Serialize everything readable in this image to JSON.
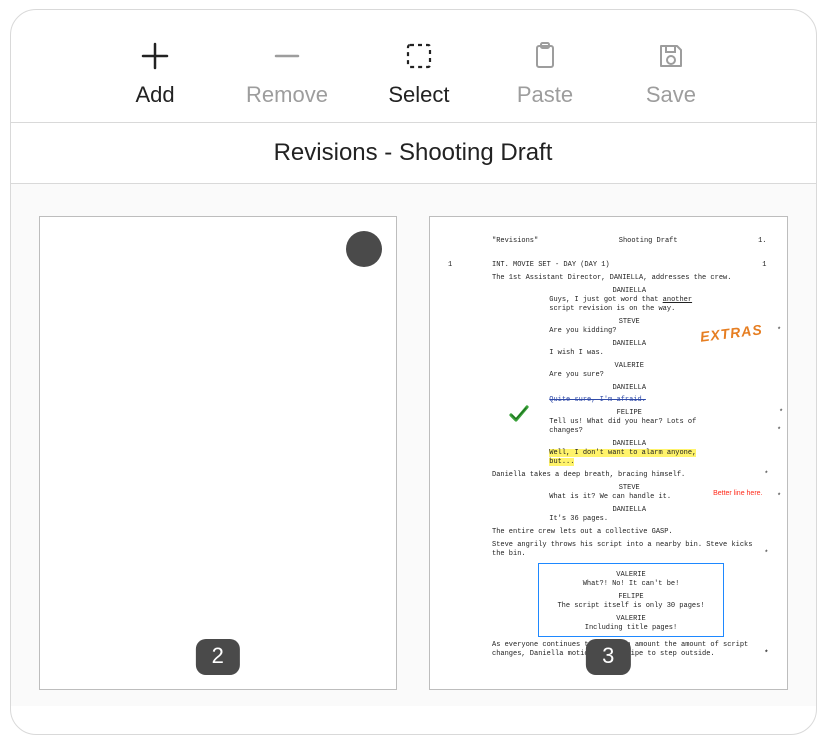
{
  "toolbar": {
    "items": [
      {
        "id": "add",
        "label": "Add",
        "enabled": true
      },
      {
        "id": "remove",
        "label": "Remove",
        "enabled": false
      },
      {
        "id": "select",
        "label": "Select",
        "enabled": true
      },
      {
        "id": "paste",
        "label": "Paste",
        "enabled": false
      },
      {
        "id": "save",
        "label": "Save",
        "enabled": false
      }
    ]
  },
  "title": "Revisions - Shooting Draft",
  "pages": {
    "left": {
      "number": "2",
      "has_marker_dot": true
    },
    "right": {
      "number": "3"
    }
  },
  "script": {
    "header_left": "\"Revisions\"",
    "header_center": "Shooting Draft",
    "header_right": "1.",
    "scene_num": "1",
    "slugline": "INT. MOVIE SET - DAY (DAY 1)",
    "action1": "The 1st Assistant Director, DANIELLA, addresses the crew.",
    "d1_char": "DANIELLA",
    "d1_line_a": "Guys, I just got word that ",
    "d1_line_a_u": "another",
    "d1_line_b": "script revision is on the way.",
    "s1_char": "STEVE",
    "s1_line": "Are you kidding?",
    "d2_char": "DANIELLA",
    "d2_line": "I wish I was.",
    "v1_char": "VALERIE",
    "v1_line": "Are you sure?",
    "d3_char": "DANIELLA",
    "d3_line_struck": "Quite sure, I'm afraid.",
    "f1_char": "FELIPE",
    "f1_line": "Tell us! What did you hear? Lots of changes?",
    "d4_char": "DANIELLA",
    "d4_line_hl": "Well, I don't want to alarm anyone, but...",
    "action2": "Daniella takes a deep breath, bracing himself.",
    "s2_char": "STEVE",
    "s2_line": "What is it?  We can handle it.",
    "d5_char": "DANIELLA",
    "d5_line": "It's 36 pages.",
    "action3": "The entire crew lets out a collective GASP.",
    "action4": "Steve angrily throws his script into a nearby bin. Steve kicks the bin.",
    "v2_char": "VALERIE",
    "v2_line": "What?! No! It can't be!",
    "f2_char": "FELIPE",
    "f2_line": "The script itself is only 30 pages!",
    "v3_char": "VALERIE",
    "v3_line": "Including title pages!",
    "action5": "As everyone continues to complain amount the amount of script changes, Daniella motions for Felipe to step outside."
  },
  "annotations": {
    "extras": "EXTRAS",
    "better_line": "Better line here."
  }
}
